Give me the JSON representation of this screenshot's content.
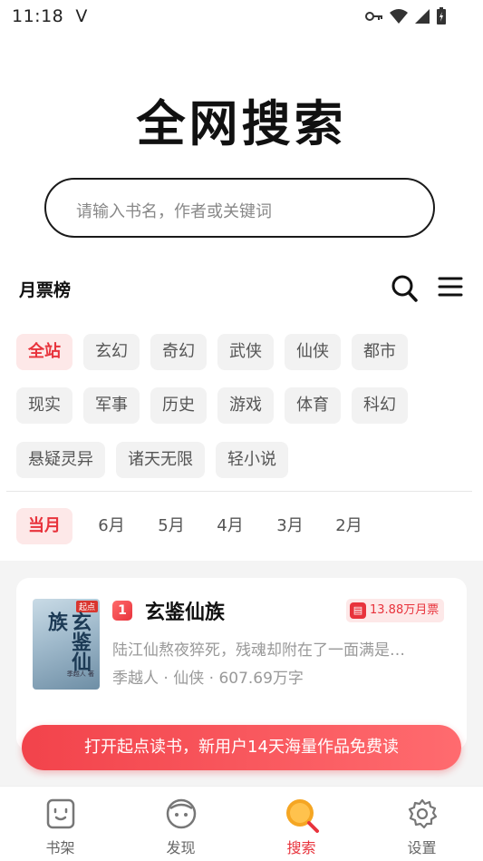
{
  "status_bar": {
    "time": "11:18",
    "carrier_icon": "V"
  },
  "logo": {
    "text": "全网搜索"
  },
  "search": {
    "placeholder": "请输入书名，作者或关键词"
  },
  "ranking": {
    "title": "月票榜"
  },
  "categories": [
    "全站",
    "玄幻",
    "奇幻",
    "武侠",
    "仙侠",
    "都市",
    "现实",
    "军事",
    "历史",
    "游戏",
    "体育",
    "科幻",
    "悬疑灵异",
    "诸天无限",
    "轻小说"
  ],
  "selected_category": "全站",
  "months": [
    "当月",
    "6月",
    "5月",
    "4月",
    "3月",
    "2月"
  ],
  "selected_month": "当月",
  "book": {
    "rank": "1",
    "title": "玄鉴仙族",
    "votes": "13.88万月票",
    "description": "陆江仙熬夜猝死，残魂却附在了一面满是…",
    "author": "季越人",
    "genre": "仙侠",
    "word_count": "607.69万字",
    "cover_title": "玄鉴仙族",
    "cover_tag": "起点",
    "cover_author": "季越人 著"
  },
  "banner": {
    "text": "打开起点读书，新用户14天海量作品免费读"
  },
  "tabbar": [
    {
      "label": "书架",
      "icon": "bookshelf-icon"
    },
    {
      "label": "发现",
      "icon": "discover-icon"
    },
    {
      "label": "搜索",
      "icon": "search-icon"
    },
    {
      "label": "设置",
      "icon": "gear-icon"
    }
  ],
  "active_tab": "搜索",
  "colors": {
    "accent": "#e8333c",
    "chip_bg": "#f2f2f2",
    "chip_active_bg": "#fde8e8"
  }
}
